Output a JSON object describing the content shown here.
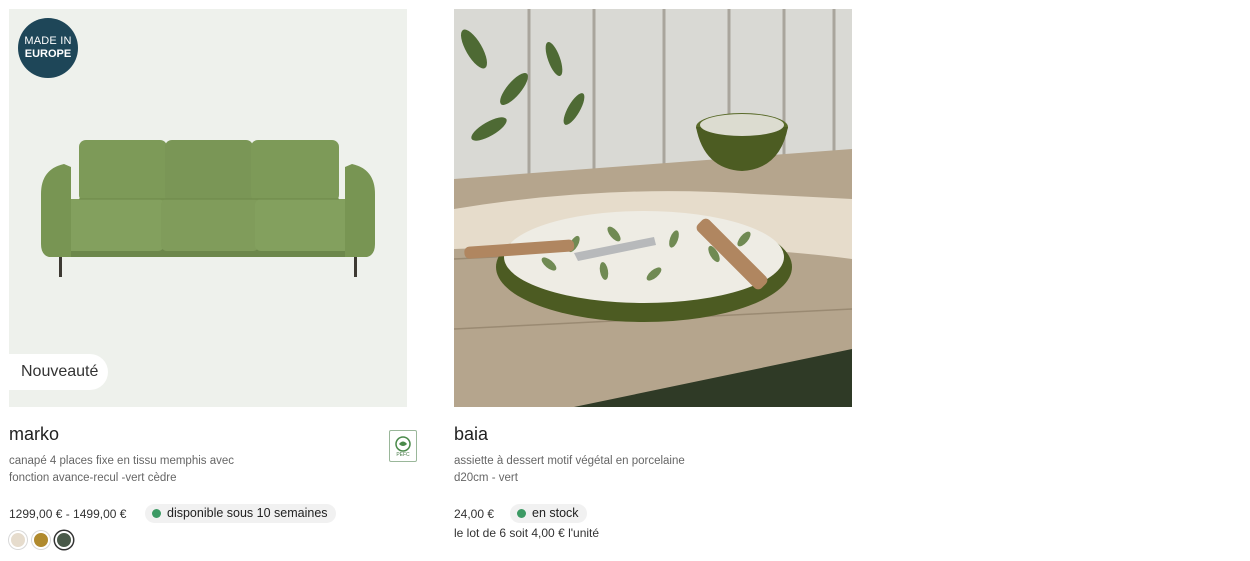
{
  "products": [
    {
      "badge_made_in": [
        "MADE IN",
        "EUROPE"
      ],
      "badge_new": "Nouveauté",
      "name": "marko",
      "description_lines": [
        "canapé 4 places fixe en tissu memphis avec",
        "fonction avance-recul -vert cèdre"
      ],
      "price": "1299,00 € - 1499,00 €",
      "availability": "disponible sous 10 semaines",
      "availability_color": "#3c9a64",
      "swatches": [
        {
          "color": "#e6dccd",
          "selected": false
        },
        {
          "color": "#b08a2e",
          "selected": false
        },
        {
          "color": "#4a5a4a",
          "selected": true
        }
      ],
      "certification_icon": "pefc-icon",
      "certification_text": "PEFC"
    },
    {
      "name": "baia",
      "description_lines": [
        "assiette à dessert motif végétal en porcelaine",
        "d20cm - vert"
      ],
      "price": "24,00 €",
      "availability": "en stock",
      "availability_color": "#3c9a64",
      "lot_text": "le lot de 6 soit 4,00 € l'unité"
    }
  ]
}
